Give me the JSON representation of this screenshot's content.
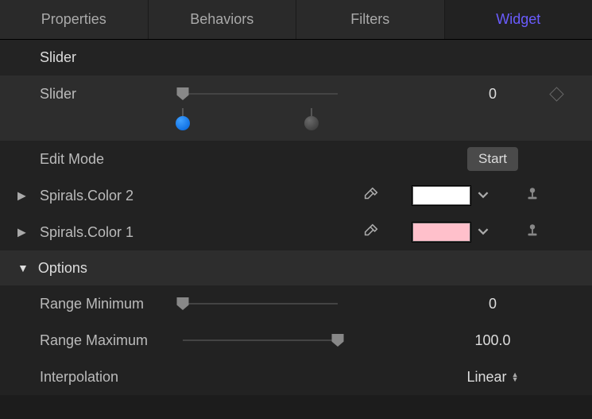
{
  "tabs": {
    "properties": "Properties",
    "behaviors": "Behaviors",
    "filters": "Filters",
    "widget": "Widget"
  },
  "section": {
    "title": "Slider"
  },
  "slider": {
    "label": "Slider",
    "value": "0"
  },
  "editMode": {
    "label": "Edit Mode",
    "button": "Start"
  },
  "colors": {
    "color2": {
      "label": "Spirals.Color 2",
      "swatch": "#ffffff"
    },
    "color1": {
      "label": "Spirals.Color 1",
      "swatch": "#ffc0cb"
    }
  },
  "options": {
    "label": "Options",
    "rangeMin": {
      "label": "Range Minimum",
      "value": "0"
    },
    "rangeMax": {
      "label": "Range Maximum",
      "value": "100.0"
    },
    "interpolation": {
      "label": "Interpolation",
      "value": "Linear"
    }
  }
}
